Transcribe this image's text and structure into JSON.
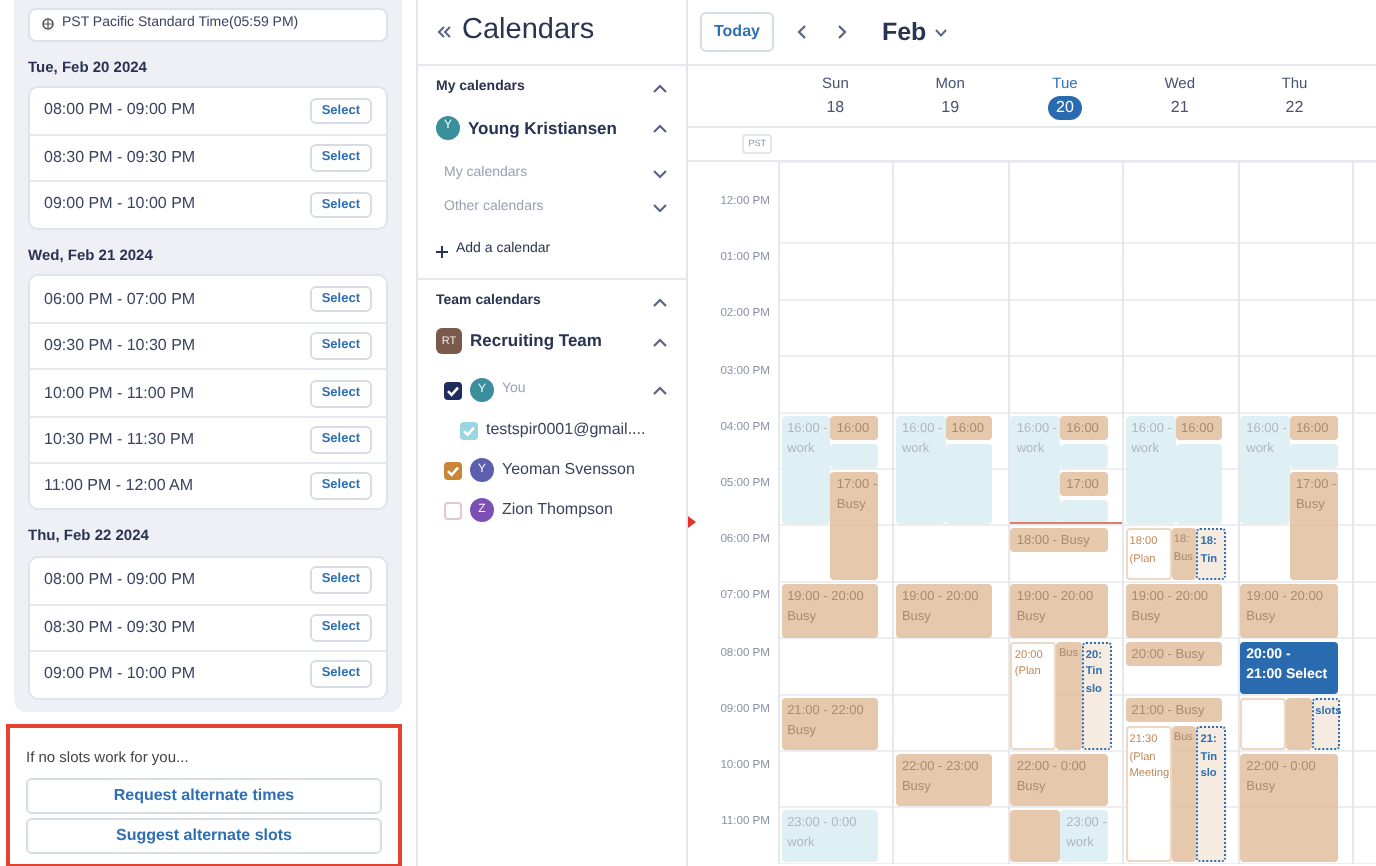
{
  "timezone": "PST Pacific Standard Time(05:59 PM)",
  "slot_days": [
    {
      "date": "Tue, Feb 20 2024",
      "slots": [
        {
          "time": "08:00 PM - 09:00 PM",
          "action": "Select"
        },
        {
          "time": "08:30 PM - 09:30 PM",
          "action": "Select"
        },
        {
          "time": "09:00 PM - 10:00 PM",
          "action": "Select"
        }
      ]
    },
    {
      "date": "Wed, Feb 21 2024",
      "slots": [
        {
          "time": "06:00 PM - 07:00 PM",
          "action": "Select"
        },
        {
          "time": "09:30 PM - 10:30 PM",
          "action": "Select"
        },
        {
          "time": "10:00 PM - 11:00 PM",
          "action": "Select"
        },
        {
          "time": "10:30 PM - 11:30 PM",
          "action": "Select"
        },
        {
          "time": "11:00 PM - 12:00 AM",
          "action": "Select"
        }
      ]
    },
    {
      "date": "Thu, Feb 22 2024",
      "slots": [
        {
          "time": "08:00 PM - 09:00 PM",
          "action": "Select"
        },
        {
          "time": "08:30 PM - 09:30 PM",
          "action": "Select"
        },
        {
          "time": "09:00 PM - 10:00 PM",
          "action": "Select"
        }
      ]
    }
  ],
  "fallback": {
    "prompt": "If no slots work for you...",
    "buttons": [
      "Request alternate times",
      "Suggest alternate slots"
    ]
  },
  "sidebar": {
    "title": "Calendars",
    "my_calendars": {
      "heading": "My calendars",
      "expanded": true,
      "owner": {
        "avatar": {
          "initial": "Y",
          "color": "#3b8e9c"
        },
        "name": "Young Kristiansen",
        "expanded": true
      },
      "groups": [
        {
          "label": "My calendars",
          "expanded": false
        },
        {
          "label": "Other calendars",
          "expanded": false
        }
      ],
      "add_label": "Add a calendar"
    },
    "team_calendars": {
      "heading": "Team calendars",
      "expanded": true,
      "team": {
        "initial": "RT",
        "name": "Recruiting Team",
        "expanded": true
      },
      "members": [
        {
          "avatar": {
            "initial": "Y",
            "color": "#3b8e9c"
          },
          "name": "You",
          "checked": true,
          "color": "#1f2c5e",
          "expanded": true,
          "children": [
            {
              "name": "testspir0001@gmail....",
              "checked": true,
              "color": "#9ad6df"
            }
          ]
        },
        {
          "avatar": {
            "initial": "Y",
            "color": "#5b5fae"
          },
          "name": "Yeoman Svensson",
          "checked": true,
          "color": "#c98538"
        },
        {
          "avatar": {
            "initial": "Z",
            "color": "#7b4fb3"
          },
          "name": "Zion Thompson",
          "checked": false,
          "color": "#e3c9c9"
        }
      ]
    }
  },
  "calendar": {
    "today": "Today",
    "month": "Feb",
    "tz": "PST",
    "hours": [
      "12:00 PM",
      "01:00 PM",
      "02:00 PM",
      "03:00 PM",
      "04:00 PM",
      "05:00 PM",
      "06:00 PM",
      "07:00 PM",
      "08:00 PM",
      "09:00 PM",
      "10:00 PM",
      "11:00 PM"
    ],
    "days": [
      {
        "weekday": "Sun",
        "date": "18",
        "selected": false,
        "events": [
          {
            "kind": "work",
            "lines": [
              "16:00 -",
              "work"
            ]
          },
          {
            "kind": "busy",
            "lines": [
              "16:00"
            ]
          },
          {
            "kind": "work"
          },
          {
            "kind": "busy",
            "lines": [
              "17:00 -",
              "Busy"
            ]
          },
          {
            "kind": "busy",
            "lines": [
              "19:00 - 20:00",
              "Busy"
            ]
          },
          {
            "kind": "busy",
            "lines": [
              "21:00 - 22:00",
              "Busy"
            ]
          },
          {
            "kind": "work",
            "lines": [
              "23:00 - 0:00",
              "work"
            ]
          }
        ]
      },
      {
        "weekday": "Mon",
        "date": "19",
        "selected": false,
        "events": [
          {
            "kind": "work",
            "lines": [
              "16:00 -",
              "work"
            ]
          },
          {
            "kind": "busy",
            "lines": [
              "16:00"
            ]
          },
          {
            "kind": "work"
          },
          {
            "kind": "busy",
            "lines": [
              "19:00 - 20:00",
              "Busy"
            ]
          },
          {
            "kind": "busy",
            "lines": [
              "22:00 - 23:00",
              "Busy"
            ]
          }
        ]
      },
      {
        "weekday": "Tue",
        "date": "20",
        "selected": true,
        "events": [
          {
            "kind": "work",
            "lines": [
              "16:00 -",
              "work"
            ]
          },
          {
            "kind": "busy",
            "lines": [
              "16:00"
            ]
          },
          {
            "kind": "work"
          },
          {
            "kind": "busy",
            "lines": [
              "17:00"
            ]
          },
          {
            "kind": "work"
          },
          {
            "kind": "busy",
            "lines": [
              "18:00 - Busy"
            ]
          },
          {
            "kind": "busy",
            "lines": [
              "19:00 - 20:00",
              "Busy"
            ]
          },
          {
            "kind": "meeting",
            "lines": [
              "20:00",
              "(Plan"
            ]
          },
          {
            "kind": "busy",
            "lines": [
              "Bus"
            ]
          },
          {
            "kind": "slot",
            "lines": [
              "20:",
              "Tin",
              "slo"
            ]
          },
          {
            "kind": "busy",
            "lines": [
              "22:00 - 0:00",
              "Busy"
            ]
          },
          {
            "kind": "busy"
          },
          {
            "kind": "work",
            "lines": [
              "23:00 -",
              "work"
            ]
          }
        ]
      },
      {
        "weekday": "Wed",
        "date": "21",
        "selected": false,
        "events": [
          {
            "kind": "work",
            "lines": [
              "16:00 -",
              "work"
            ]
          },
          {
            "kind": "busy",
            "lines": [
              "16:00"
            ]
          },
          {
            "kind": "work"
          },
          {
            "kind": "meeting",
            "lines": [
              "18:00",
              "(Plan"
            ]
          },
          {
            "kind": "busy",
            "lines": [
              "18:",
              "Bus"
            ]
          },
          {
            "kind": "slot",
            "lines": [
              "18:",
              "Tin"
            ]
          },
          {
            "kind": "busy",
            "lines": [
              "19:00 - 20:00",
              "Busy"
            ]
          },
          {
            "kind": "busy",
            "lines": [
              "20:00 - Busy"
            ]
          },
          {
            "kind": "busy",
            "lines": [
              "21:00 - Busy"
            ]
          },
          {
            "kind": "meeting",
            "lines": [
              "21:30",
              "(Plan",
              "Meeting"
            ]
          },
          {
            "kind": "busy",
            "lines": [
              "Bus"
            ]
          },
          {
            "kind": "slot",
            "lines": [
              "21:",
              "Tin",
              "slo"
            ]
          }
        ]
      },
      {
        "weekday": "Thu",
        "date": "22",
        "selected": false,
        "events": [
          {
            "kind": "work",
            "lines": [
              "16:00 -",
              "work"
            ]
          },
          {
            "kind": "busy",
            "lines": [
              "16:00"
            ]
          },
          {
            "kind": "work"
          },
          {
            "kind": "busy",
            "lines": [
              "17:00 -",
              "Busy"
            ]
          },
          {
            "kind": "busy",
            "lines": [
              "19:00 - 20:00",
              "Busy"
            ]
          },
          {
            "kind": "selected",
            "lines": [
              "20:00 -",
              "21:00 Select"
            ]
          },
          {
            "kind": "meeting"
          },
          {
            "kind": "busy"
          },
          {
            "kind": "slot",
            "lines": [
              "slots"
            ]
          },
          {
            "kind": "busy",
            "lines": [
              "22:00 - 0:00",
              "Busy"
            ]
          }
        ]
      }
    ]
  }
}
